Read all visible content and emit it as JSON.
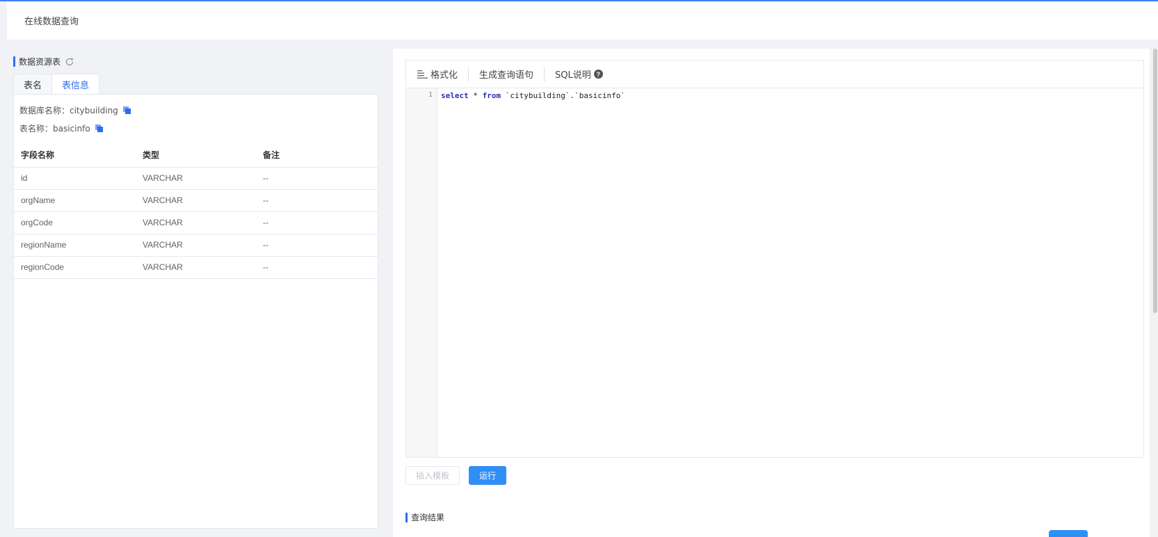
{
  "colors": {
    "accent": "#2f6bf2",
    "primary_button": "#2f8ff5",
    "keyword": "#2a2fb5"
  },
  "header": {
    "title": "在线数据查询"
  },
  "left": {
    "section_title": "数据资源表",
    "refresh_icon": "refresh-icon",
    "tabs": [
      {
        "label": "表名",
        "active": false
      },
      {
        "label": "表信息",
        "active": true
      }
    ],
    "info": {
      "db_label": "数据库名称：citybuilding",
      "table_label": "表名称：basicinfo"
    },
    "table": {
      "headers": [
        "字段名称",
        "类型",
        "备注"
      ],
      "rows": [
        [
          "id",
          "VARCHAR",
          "--"
        ],
        [
          "orgName",
          "VARCHAR",
          "--"
        ],
        [
          "orgCode",
          "VARCHAR",
          "--"
        ],
        [
          "regionName",
          "VARCHAR",
          "--"
        ],
        [
          "regionCode",
          "VARCHAR",
          "--"
        ]
      ]
    }
  },
  "editor": {
    "toolbar": {
      "format_label": "格式化",
      "generate_label": "生成查询语句",
      "sql_help_label": "SQL说明",
      "help_glyph": "?"
    },
    "line_number": "1",
    "code": {
      "kw_select": "select",
      "star": " * ",
      "kw_from": "from",
      "rest": " `citybuilding`.`basicinfo`"
    }
  },
  "buttons": {
    "insert_template": "插入模板",
    "run": "运行"
  },
  "result": {
    "title": "查询结果"
  }
}
